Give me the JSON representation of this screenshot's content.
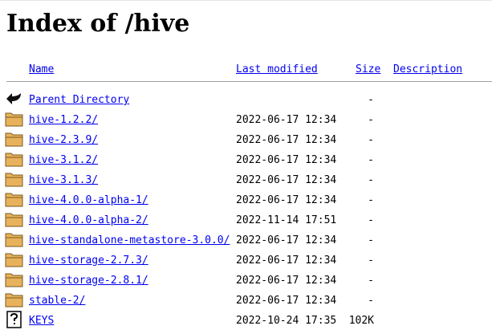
{
  "page": {
    "title": "Index of /hive"
  },
  "columns": {
    "name": "Name",
    "last_modified": "Last modified",
    "size": "Size",
    "description": "Description"
  },
  "parent": {
    "label": "Parent Directory",
    "size": "-",
    "icon": "back-arrow-icon"
  },
  "entries": [
    {
      "name": "hive-1.2.2/",
      "modified": "2022-06-17 12:34",
      "size": "-",
      "description": "",
      "icon": "folder-icon"
    },
    {
      "name": "hive-2.3.9/",
      "modified": "2022-06-17 12:34",
      "size": "-",
      "description": "",
      "icon": "folder-icon"
    },
    {
      "name": "hive-3.1.2/",
      "modified": "2022-06-17 12:34",
      "size": "-",
      "description": "",
      "icon": "folder-icon"
    },
    {
      "name": "hive-3.1.3/",
      "modified": "2022-06-17 12:34",
      "size": "-",
      "description": "",
      "icon": "folder-icon"
    },
    {
      "name": "hive-4.0.0-alpha-1/",
      "modified": "2022-06-17 12:34",
      "size": "-",
      "description": "",
      "icon": "folder-icon"
    },
    {
      "name": "hive-4.0.0-alpha-2/",
      "modified": "2022-11-14 17:51",
      "size": "-",
      "description": "",
      "icon": "folder-icon"
    },
    {
      "name": "hive-standalone-metastore-3.0.0/",
      "modified": "2022-06-17 12:34",
      "size": "-",
      "description": "",
      "icon": "folder-icon"
    },
    {
      "name": "hive-storage-2.7.3/",
      "modified": "2022-06-17 12:34",
      "size": "-",
      "description": "",
      "icon": "folder-icon"
    },
    {
      "name": "hive-storage-2.8.1/",
      "modified": "2022-06-17 12:34",
      "size": "-",
      "description": "",
      "icon": "folder-icon"
    },
    {
      "name": "stable-2/",
      "modified": "2022-06-17 12:34",
      "size": "-",
      "description": "",
      "icon": "folder-icon"
    },
    {
      "name": "KEYS",
      "modified": "2022-10-24 17:35",
      "size": "102K",
      "description": "",
      "icon": "unknown-file-icon"
    }
  ],
  "colors": {
    "link": "#0000ee",
    "folder_fill": "#e8b25c",
    "folder_outline": "#7a5a1e",
    "rule": "#a0a0a0"
  }
}
